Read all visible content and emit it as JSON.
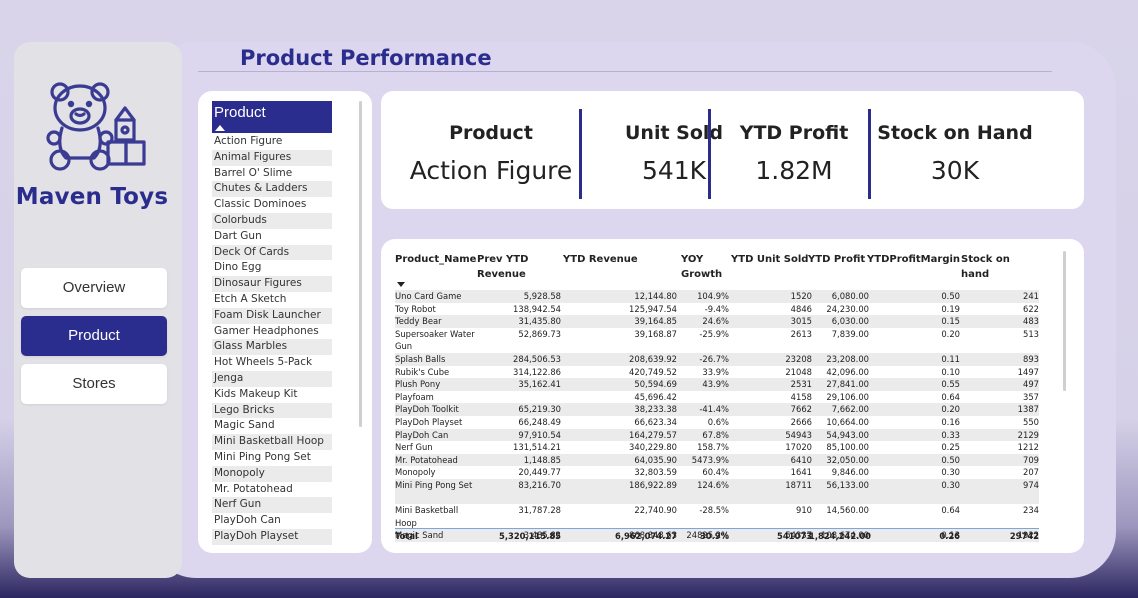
{
  "app": {
    "brand": "Maven Toys",
    "page_title": "Product Performance",
    "accent_color": "#2b2d8e"
  },
  "nav": [
    {
      "label": "Overview",
      "active": false
    },
    {
      "label": "Product",
      "active": true
    },
    {
      "label": "Stores",
      "active": false
    }
  ],
  "slicer": {
    "title": "Product",
    "items": [
      "Action Figure",
      "Animal Figures",
      "Barrel O' Slime",
      "Chutes & Ladders",
      "Classic Dominoes",
      "Colorbuds",
      "Dart Gun",
      "Deck Of Cards",
      "Dino Egg",
      "Dinosaur Figures",
      "Etch A Sketch",
      "Foam Disk Launcher",
      "Gamer Headphones",
      "Glass Marbles",
      "Hot Wheels 5-Pack",
      "Jenga",
      "Kids Makeup Kit",
      "Lego Bricks",
      "Magic Sand",
      "Mini Basketball Hoop",
      "Mini Ping Pong Set",
      "Monopoly",
      "Mr. Potatohead",
      "Nerf Gun",
      "PlayDoh Can",
      "PlayDoh Playset"
    ]
  },
  "kpis": [
    {
      "label": "Product",
      "value": "Action Figure"
    },
    {
      "label": "Unit Sold",
      "value": "541K"
    },
    {
      "label": "YTD Profit",
      "value": "1.82M"
    },
    {
      "label": "Stock on Hand",
      "value": "30K"
    }
  ],
  "table": {
    "headers": [
      {
        "label": "Product_Name"
      },
      {
        "label": "Prev YTD Revenue"
      },
      {
        "label": "YTD Revenue"
      },
      {
        "label": "YOY Growth"
      },
      {
        "label": "YTD Unit Sold"
      },
      {
        "label": "YTD Profit"
      },
      {
        "label": "YTDProfitMargin"
      },
      {
        "label": "Stock on hand"
      }
    ],
    "rows": [
      [
        "Uno Card Game",
        "5,928.58",
        "12,144.80",
        "104.9%",
        "1520",
        "6,080.00",
        "0.50",
        "241"
      ],
      [
        "Toy Robot",
        "138,942.54",
        "125,947.54",
        "-9.4%",
        "4846",
        "24,230.00",
        "0.19",
        "622"
      ],
      [
        "Teddy Bear",
        "31,435.80",
        "39,164.85",
        "24.6%",
        "3015",
        "6,030.00",
        "0.15",
        "483"
      ],
      [
        "Supersoaker Water Gun",
        "52,869.73",
        "39,168.87",
        "-25.9%",
        "2613",
        "7,839.00",
        "0.20",
        "513"
      ],
      [
        "Splash Balls",
        "284,506.53",
        "208,639.92",
        "-26.7%",
        "23208",
        "23,208.00",
        "0.11",
        "893"
      ],
      [
        "Rubik's Cube",
        "314,122.86",
        "420,749.52",
        "33.9%",
        "21048",
        "42,096.00",
        "0.10",
        "1497"
      ],
      [
        "Plush Pony",
        "35,162.41",
        "50,594.69",
        "43.9%",
        "2531",
        "27,841.00",
        "0.55",
        "497"
      ],
      [
        "Playfoam",
        "",
        "45,696.42",
        "",
        "4158",
        "29,106.00",
        "0.64",
        "357"
      ],
      [
        "PlayDoh Toolkit",
        "65,219.30",
        "38,233.38",
        "-41.4%",
        "7662",
        "7,662.00",
        "0.20",
        "1387"
      ],
      [
        "PlayDoh Playset",
        "66,248.49",
        "66,623.34",
        "0.6%",
        "2666",
        "10,664.00",
        "0.16",
        "550"
      ],
      [
        "PlayDoh Can",
        "97,910.54",
        "164,279.57",
        "67.8%",
        "54943",
        "54,943.00",
        "0.33",
        "2129"
      ],
      [
        "Nerf Gun",
        "131,514.21",
        "340,229.80",
        "158.7%",
        "17020",
        "85,100.00",
        "0.25",
        "1212"
      ],
      [
        "Mr. Potatohead",
        "1,148.85",
        "64,035.90",
        "5473.9%",
        "6410",
        "32,050.00",
        "0.50",
        "709"
      ],
      [
        "Monopoly",
        "20,449.77",
        "32,803.59",
        "60.4%",
        "1641",
        "9,846.00",
        "0.30",
        "207"
      ],
      [
        "Mini Ping Pong Set",
        "83,216.70",
        "186,922.89",
        "124.6%",
        "18711",
        "56,133.00",
        "0.30",
        "974"
      ],
      [
        "Mini Basketball Hoop",
        "31,787.28",
        "22,740.90",
        "-28.5%",
        "910",
        "14,560.00",
        "0.64",
        "234"
      ],
      [
        "Magic Sand",
        "3,485.82",
        "868,848.63",
        "24825.2%",
        "54337",
        "108,674.00",
        "0.13",
        "1922"
      ]
    ],
    "total": [
      "Total",
      "5,320,115.85",
      "6,962,074.27",
      "30.9%",
      "541073",
      "1,824,242.00",
      "0.26",
      "29742"
    ]
  }
}
